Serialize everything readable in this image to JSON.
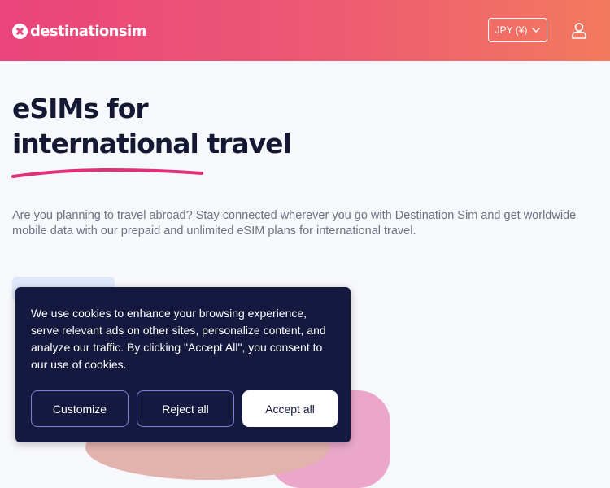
{
  "header": {
    "logo_text": "destinationsim",
    "currency_label": "JPY (¥)",
    "icons": {
      "logo": "destinationsim-logo-icon",
      "chevron": "chevron-down-icon",
      "account": "user-icon"
    }
  },
  "hero": {
    "title_line1": "eSIMs for",
    "title_line2": "international travel",
    "intro": "Are you planning to travel abroad? Stay connected wherever you go with Destination Sim and get worldwide mobile data with our prepaid and unlimited eSIM plans for international travel."
  },
  "cookie_banner": {
    "text": "We use cookies to enhance your browsing experience, serve relevant ads on other sites, personalize content, and analyze our traffic. By clicking \"Accept All\", you consent to our use of cookies.",
    "customize_label": "Customize",
    "reject_label": "Reject all",
    "accept_label": "Accept all"
  },
  "colors": {
    "header_gradient_start": "#e9447c",
    "header_gradient_end": "#f27a5e",
    "accent_underline": "#e0307a",
    "banner_bg": "#15183f",
    "banner_button_border": "#7b80d8"
  }
}
